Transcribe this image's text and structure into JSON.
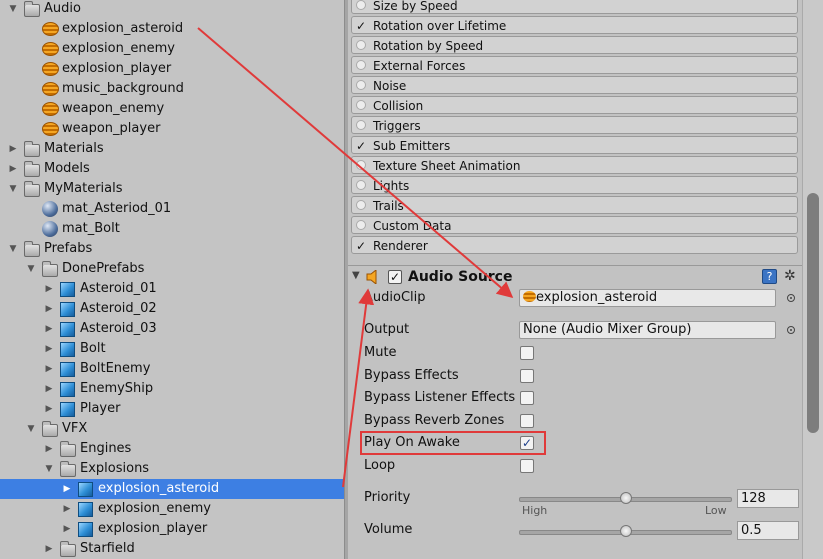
{
  "tree": {
    "rows": [
      {
        "label": "Audio",
        "icon": "folder",
        "depth": 0,
        "expanded": true
      },
      {
        "label": "explosion_asteroid",
        "icon": "audio-clip",
        "depth": 1
      },
      {
        "label": "explosion_enemy",
        "icon": "audio-clip",
        "depth": 1
      },
      {
        "label": "explosion_player",
        "icon": "audio-clip",
        "depth": 1
      },
      {
        "label": "music_background",
        "icon": "audio-clip",
        "depth": 1
      },
      {
        "label": "weapon_enemy",
        "icon": "audio-clip",
        "depth": 1
      },
      {
        "label": "weapon_player",
        "icon": "audio-clip",
        "depth": 1
      },
      {
        "label": "Materials",
        "icon": "folder",
        "depth": 0,
        "expanded": false
      },
      {
        "label": "Models",
        "icon": "folder",
        "depth": 0,
        "expanded": false
      },
      {
        "label": "MyMaterials",
        "icon": "folder",
        "depth": 0,
        "expanded": true
      },
      {
        "label": "mat_Asteriod_01",
        "icon": "material",
        "depth": 1
      },
      {
        "label": "mat_Bolt",
        "icon": "material",
        "depth": 1
      },
      {
        "label": "Prefabs",
        "icon": "folder",
        "depth": 0,
        "expanded": true
      },
      {
        "label": "DonePrefabs",
        "icon": "folder",
        "depth": 1,
        "expanded": true
      },
      {
        "label": "Asteroid_01",
        "icon": "prefab",
        "depth": 2,
        "expanded": false
      },
      {
        "label": "Asteroid_02",
        "icon": "prefab",
        "depth": 2,
        "expanded": false
      },
      {
        "label": "Asteroid_03",
        "icon": "prefab",
        "depth": 2,
        "expanded": false
      },
      {
        "label": "Bolt",
        "icon": "prefab",
        "depth": 2,
        "expanded": false
      },
      {
        "label": "BoltEnemy",
        "icon": "prefab",
        "depth": 2,
        "expanded": false
      },
      {
        "label": "EnemyShip",
        "icon": "prefab",
        "depth": 2,
        "expanded": false
      },
      {
        "label": "Player",
        "icon": "prefab",
        "depth": 2,
        "expanded": false
      },
      {
        "label": "VFX",
        "icon": "folder",
        "depth": 1,
        "expanded": true
      },
      {
        "label": "Engines",
        "icon": "folder",
        "depth": 2,
        "expanded": false
      },
      {
        "label": "Explosions",
        "icon": "folder",
        "depth": 2,
        "expanded": true
      },
      {
        "label": "explosion_asteroid",
        "icon": "prefab",
        "depth": 3,
        "expanded": false,
        "selected": true
      },
      {
        "label": "explosion_enemy",
        "icon": "prefab",
        "depth": 3,
        "expanded": false
      },
      {
        "label": "explosion_player",
        "icon": "prefab",
        "depth": 3,
        "expanded": false
      },
      {
        "label": "Starfield",
        "icon": "folder",
        "depth": 2,
        "expanded": false
      }
    ]
  },
  "particle_modules": [
    {
      "label": "Size by Speed",
      "enabled": false
    },
    {
      "label": "Rotation over Lifetime",
      "enabled": true
    },
    {
      "label": "Rotation by Speed",
      "enabled": false
    },
    {
      "label": "External Forces",
      "enabled": false
    },
    {
      "label": "Noise",
      "enabled": false
    },
    {
      "label": "Collision",
      "enabled": false
    },
    {
      "label": "Triggers",
      "enabled": false
    },
    {
      "label": "Sub Emitters",
      "enabled": true
    },
    {
      "label": "Texture Sheet Animation",
      "enabled": false
    },
    {
      "label": "Lights",
      "enabled": false
    },
    {
      "label": "Trails",
      "enabled": false
    },
    {
      "label": "Custom Data",
      "enabled": false
    },
    {
      "label": "Renderer",
      "enabled": true
    }
  ],
  "audio_source": {
    "title": "Audio Source",
    "enabled_mark": "✓",
    "help_glyph": "?",
    "gear_glyph": "✲",
    "audioclip_label": "AudioClip",
    "audioclip_value": "explosion_asteroid",
    "output_label": "Output",
    "output_value": "None (Audio Mixer Group)",
    "toggles": [
      {
        "label": "Mute",
        "checked": false
      },
      {
        "label": "Bypass Effects",
        "checked": false
      },
      {
        "label": "Bypass Listener Effects",
        "checked": false
      },
      {
        "label": "Bypass Reverb Zones",
        "checked": false
      },
      {
        "label": "Play On Awake",
        "checked": true
      },
      {
        "label": "Loop",
        "checked": false
      }
    ],
    "priority_label": "Priority",
    "priority_value": "128",
    "priority_fraction": 0.5,
    "priority_low": "High",
    "priority_high": "Low",
    "volume_label": "Volume",
    "volume_value": "0.5",
    "volume_fraction": 0.5
  },
  "colors": {
    "selection": "#3d7fe3",
    "annotation": "#e03a3a"
  }
}
